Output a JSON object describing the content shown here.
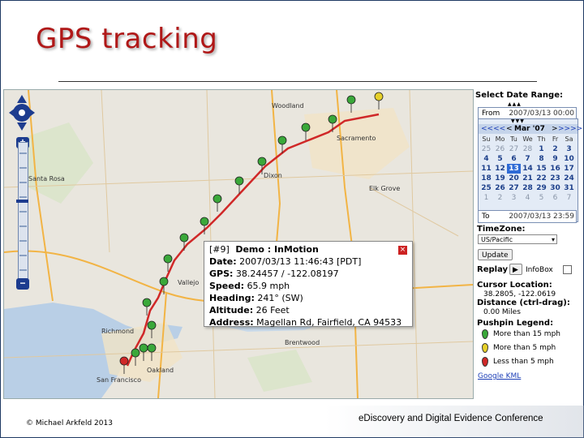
{
  "slide": {
    "title": "GPS tracking",
    "footer_left": "© Michael Arkfeld 2013",
    "footer_right": "eDiscovery and Digital Evidence Conference"
  },
  "map": {
    "places": [
      {
        "name": "Woodland"
      },
      {
        "name": "Sacramento"
      },
      {
        "name": "Elk Grove"
      },
      {
        "name": "Santa Rosa"
      },
      {
        "name": "Dixon"
      },
      {
        "name": "Vallejo"
      },
      {
        "name": "Richmond"
      },
      {
        "name": "Oakland"
      },
      {
        "name": "San Francisco"
      },
      {
        "name": "Brentwood"
      }
    ],
    "colors": {
      "route": "#d02828",
      "fast": "#3aa83a",
      "medium": "#e6d02a",
      "slow": "#d02828"
    }
  },
  "popup": {
    "header": "[#9]",
    "title": "Demo : InMotion",
    "date_key": "Date:",
    "date_val": "2007/03/13 11:46:43 [PDT]",
    "gps_key": "GPS:",
    "gps_val": "38.24457 / -122.08197",
    "speed_key": "Speed:",
    "speed_val": "65.9 mph",
    "heading_key": "Heading:",
    "heading_val": "241° (SW)",
    "altitude_key": "Altitude:",
    "altitude_val": "26 Feet",
    "address_key": "Address:",
    "address_val": "Magellan Rd, Fairfield, CA 94533",
    "close_glyph": "×"
  },
  "panel": {
    "title": "Select Date Range:",
    "from_label": "From",
    "from_value": "2007/03/13 00:00",
    "arrows_up": "▲▲▲",
    "arrows_down": "▼▼▼",
    "prev_year": "<<<<",
    "prev_month": "<",
    "month": "Mar '07",
    "next_month": ">",
    "next_year": ">>>>",
    "weekdays": [
      "Su",
      "Mo",
      "Tu",
      "We",
      "Th",
      "Fr",
      "Sa"
    ],
    "to_label": "To",
    "to_value": "2007/03/13 23:59",
    "timezone_label": "TimeZone:",
    "timezone_value": "US/Pacific",
    "update_button": "Update",
    "replay_label": "Replay",
    "replay_play": "▶",
    "infobox_label": "InfoBox",
    "cursor_label": "Cursor Location:",
    "cursor_value": "38.2805, -122.0619",
    "distance_label": "Distance (ctrl-drag):",
    "distance_value": "0.00 Miles",
    "legend_title": "Pushpin Legend:",
    "legend": [
      {
        "label": "More than 15 mph",
        "color": "#3aa83a"
      },
      {
        "label": "More than 5 mph",
        "color": "#e6d02a"
      },
      {
        "label": "Less than 5 mph",
        "color": "#d02828"
      }
    ],
    "kml_link": "Google KML"
  },
  "calendar": {
    "rows": [
      [
        {
          "d": "25",
          "c": "dim"
        },
        {
          "d": "26",
          "c": "dim"
        },
        {
          "d": "27",
          "c": "dim"
        },
        {
          "d": "28",
          "c": "dim"
        },
        {
          "d": "1",
          "c": "cur"
        },
        {
          "d": "2",
          "c": "cur"
        },
        {
          "d": "3",
          "c": "cur"
        }
      ],
      [
        {
          "d": "4",
          "c": "cur"
        },
        {
          "d": "5",
          "c": "cur"
        },
        {
          "d": "6",
          "c": "cur"
        },
        {
          "d": "7",
          "c": "cur"
        },
        {
          "d": "8",
          "c": "cur"
        },
        {
          "d": "9",
          "c": "cur"
        },
        {
          "d": "10",
          "c": "cur"
        }
      ],
      [
        {
          "d": "11",
          "c": "cur"
        },
        {
          "d": "12",
          "c": "cur"
        },
        {
          "d": "13",
          "c": "sel"
        },
        {
          "d": "14",
          "c": "cur"
        },
        {
          "d": "15",
          "c": "cur"
        },
        {
          "d": "16",
          "c": "cur"
        },
        {
          "d": "17",
          "c": "cur"
        }
      ],
      [
        {
          "d": "18",
          "c": "cur"
        },
        {
          "d": "19",
          "c": "cur"
        },
        {
          "d": "20",
          "c": "cur"
        },
        {
          "d": "21",
          "c": "cur"
        },
        {
          "d": "22",
          "c": "cur"
        },
        {
          "d": "23",
          "c": "cur"
        },
        {
          "d": "24",
          "c": "cur"
        }
      ],
      [
        {
          "d": "25",
          "c": "cur"
        },
        {
          "d": "26",
          "c": "cur"
        },
        {
          "d": "27",
          "c": "cur"
        },
        {
          "d": "28",
          "c": "cur"
        },
        {
          "d": "29",
          "c": "cur"
        },
        {
          "d": "30",
          "c": "cur"
        },
        {
          "d": "31",
          "c": "cur"
        }
      ],
      [
        {
          "d": "1",
          "c": "dim"
        },
        {
          "d": "2",
          "c": "dim"
        },
        {
          "d": "3",
          "c": "dim"
        },
        {
          "d": "4",
          "c": "dim"
        },
        {
          "d": "5",
          "c": "dim"
        },
        {
          "d": "6",
          "c": "dim"
        },
        {
          "d": "7",
          "c": "dim"
        }
      ]
    ]
  }
}
